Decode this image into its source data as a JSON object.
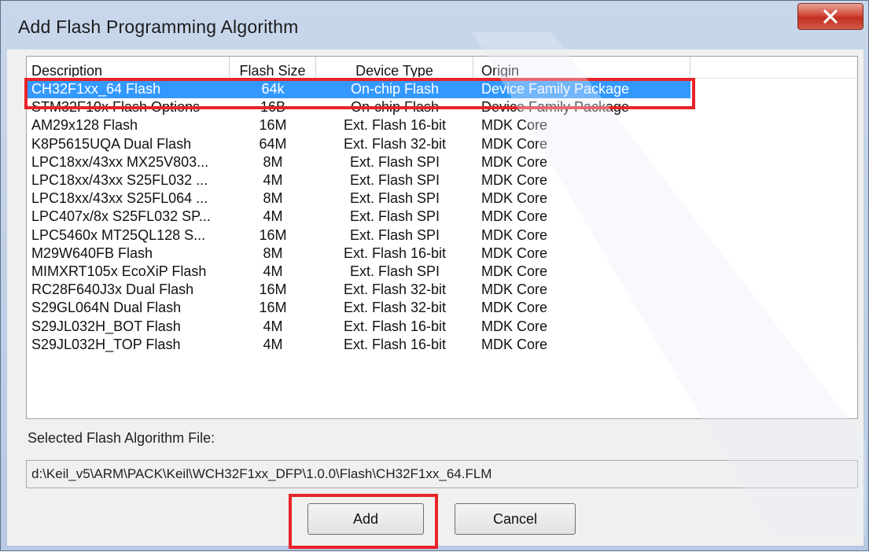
{
  "window": {
    "title": "Add Flash Programming Algorithm",
    "close_label": "X"
  },
  "list": {
    "columns": [
      "Description",
      "Flash Size",
      "Device Type",
      "Origin"
    ],
    "rows": [
      {
        "description": "CH32F1xx_64 Flash",
        "size": "64k",
        "type": "On-chip Flash",
        "origin": "Device Family Package",
        "selected": true
      },
      {
        "description": "STM32F10x Flash Options",
        "size": "16B",
        "type": "On-chip Flash",
        "origin": "Device Family Package"
      },
      {
        "description": "AM29x128 Flash",
        "size": "16M",
        "type": "Ext. Flash 16-bit",
        "origin": "MDK Core"
      },
      {
        "description": "K8P5615UQA Dual Flash",
        "size": "64M",
        "type": "Ext. Flash 32-bit",
        "origin": "MDK Core"
      },
      {
        "description": "LPC18xx/43xx MX25V803...",
        "size": "8M",
        "type": "Ext. Flash SPI",
        "origin": "MDK Core"
      },
      {
        "description": "LPC18xx/43xx S25FL032 ...",
        "size": "4M",
        "type": "Ext. Flash SPI",
        "origin": "MDK Core"
      },
      {
        "description": "LPC18xx/43xx S25FL064 ...",
        "size": "8M",
        "type": "Ext. Flash SPI",
        "origin": "MDK Core"
      },
      {
        "description": "LPC407x/8x S25FL032 SP...",
        "size": "4M",
        "type": "Ext. Flash SPI",
        "origin": "MDK Core"
      },
      {
        "description": "LPC5460x MT25QL128 S...",
        "size": "16M",
        "type": "Ext. Flash SPI",
        "origin": "MDK Core"
      },
      {
        "description": "M29W640FB Flash",
        "size": "8M",
        "type": "Ext. Flash 16-bit",
        "origin": "MDK Core"
      },
      {
        "description": "MIMXRT105x EcoXiP Flash",
        "size": "4M",
        "type": "Ext. Flash SPI",
        "origin": "MDK Core"
      },
      {
        "description": "RC28F640J3x Dual Flash",
        "size": "16M",
        "type": "Ext. Flash 32-bit",
        "origin": "MDK Core"
      },
      {
        "description": "S29GL064N Dual Flash",
        "size": "16M",
        "type": "Ext. Flash 32-bit",
        "origin": "MDK Core"
      },
      {
        "description": "S29JL032H_BOT Flash",
        "size": "4M",
        "type": "Ext. Flash 16-bit",
        "origin": "MDK Core"
      },
      {
        "description": "S29JL032H_TOP Flash",
        "size": "4M",
        "type": "Ext. Flash 16-bit",
        "origin": "MDK Core"
      }
    ]
  },
  "selected_file": {
    "label": "Selected Flash Algorithm File:",
    "path": "d:\\Keil_v5\\ARM\\PACK\\Keil\\WCH32F1xx_DFP\\1.0.0\\Flash\\CH32F1xx_64.FLM"
  },
  "buttons": {
    "add_label": "Add",
    "cancel_label": "Cancel"
  },
  "colors": {
    "selection": "#3399ff",
    "highlight_box": "#e8242a",
    "title_bar": "#c9d7eb"
  }
}
